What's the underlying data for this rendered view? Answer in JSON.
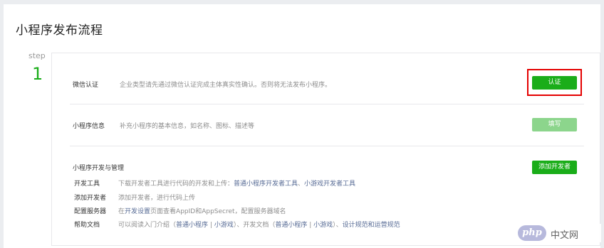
{
  "page": {
    "title": "小程序发布流程"
  },
  "step": {
    "label": "step",
    "number": "1"
  },
  "rows": {
    "verify": {
      "title": "微信认证",
      "desc": "企业类型请先通过微信认证完成主体真实性确认。否则将无法发布小程序。",
      "button": "认证"
    },
    "info": {
      "title": "小程序信息",
      "desc": "补充小程序的基本信息，如名称、图标、描述等",
      "button": "填写"
    },
    "dev": {
      "title": "小程序开发与管理",
      "button": "添加开发者",
      "items": [
        {
          "label": "开发工具",
          "text1": "下载开发者工具进行代码的开发和上传：",
          "link1": "普通小程序开发者工具",
          "sep1": "、",
          "link2": "小游戏开发者工具"
        },
        {
          "label": "添加开发者",
          "text1": "添加开发者，进行代码上传"
        },
        {
          "label": "配置服务器",
          "text1": "在",
          "link1": "开发设置",
          "text2": "页面查看AppID和AppSecret，配置服务器域名"
        },
        {
          "label": "帮助文档",
          "text1": "可以阅读入门介绍（",
          "link1": "普通小程序",
          "sep1": " | ",
          "link2": "小游戏",
          "text2": "）、开发文档（",
          "link3": "普通小程序",
          "sep2": " | ",
          "link4": "小游戏",
          "text3": "）、",
          "link5": "设计规范和运营规范"
        }
      ]
    }
  },
  "watermark": {
    "logo": "php",
    "text": "中文网"
  }
}
